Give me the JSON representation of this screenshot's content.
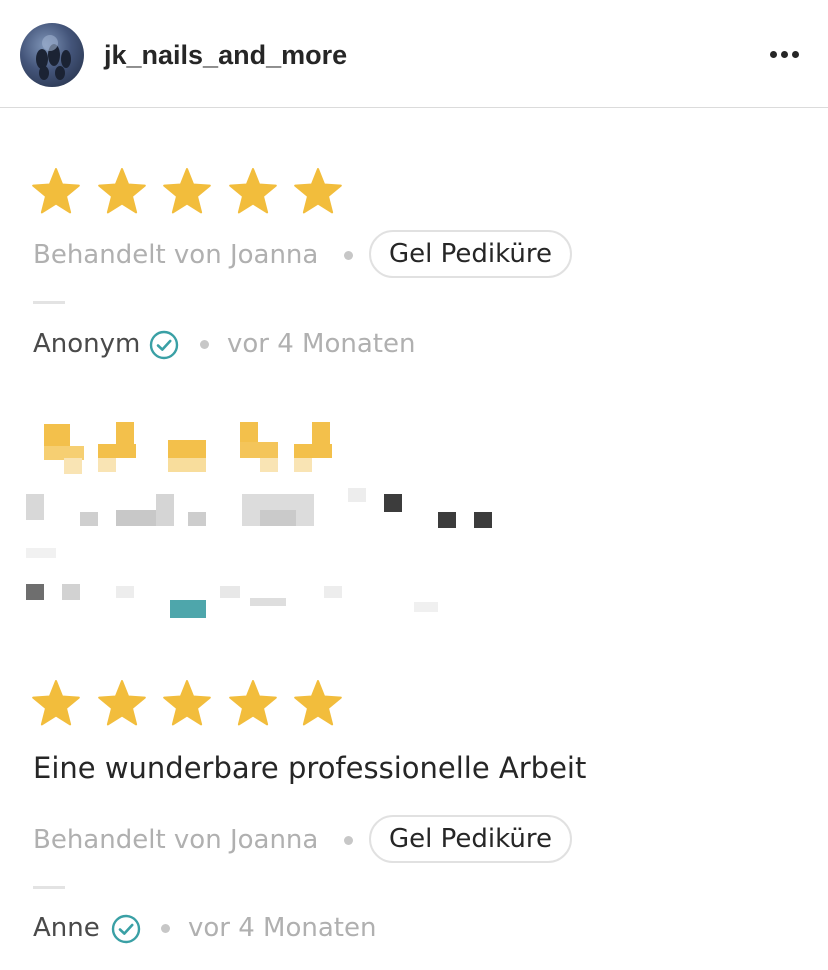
{
  "header": {
    "username": "jk_nails_and_more",
    "more_icon": "more-horizontal-icon"
  },
  "colors": {
    "star": "#f2bd3c",
    "verified": "#3aa0a5",
    "muted_text": "#b0b0b0",
    "primary_text": "#262626"
  },
  "reviews": [
    {
      "rating": 5,
      "title": "",
      "treated_by": "Behandelt von Joanna",
      "service": "Gel Pediküre",
      "author": "Anonym",
      "verified": true,
      "time_ago": "vor 4 Monaten"
    },
    {
      "rating": 5,
      "title": "Eine wunderbare professionelle Arbeit",
      "treated_by": "Behandelt von Joanna",
      "service": "Gel Pediküre",
      "author": "Anne",
      "verified": true,
      "time_ago": "vor 4 Monaten"
    }
  ]
}
